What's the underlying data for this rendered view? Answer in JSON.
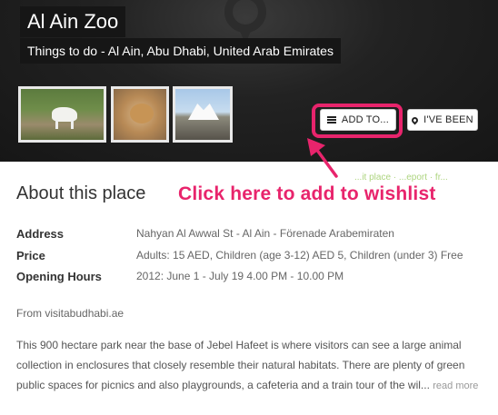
{
  "place": {
    "title": "Al Ain Zoo",
    "subtitle": "Things to do - Al Ain, Abu Dhabi, United Arab Emirates"
  },
  "actions": {
    "add_to_label": "ADD TO...",
    "been_label": "I'VE BEEN"
  },
  "annotation": {
    "text": "Click here to add to wishlist",
    "color": "#e8246c"
  },
  "ghost_links": "...it place · ...eport · fr...",
  "about": {
    "heading": "About this place",
    "rows": [
      {
        "label": "Address",
        "value": "Nahyan Al Awwal St - Al Ain - Förenade Arabemiraten"
      },
      {
        "label": "Price",
        "value": "Adults: 15 AED, Children (age 3-12) AED 5, Children (under 3) Free"
      },
      {
        "label": "Opening Hours",
        "value": "2012: June 1 - July 19 4.00 PM - 10.00 PM"
      }
    ],
    "source": "From visitabudhabi.ae",
    "description": "This 900 hectare park near the base of Jebel Hafeet is where visitors can see a large animal collection in enclosures that closely resemble their natural habitats. There are plenty of green public spaces for picnics and also playgrounds, a cafeteria and a train tour of the wil...",
    "read_more": "read more"
  },
  "icons": {
    "add_to": "list-icon",
    "been": "map-pin-icon"
  }
}
